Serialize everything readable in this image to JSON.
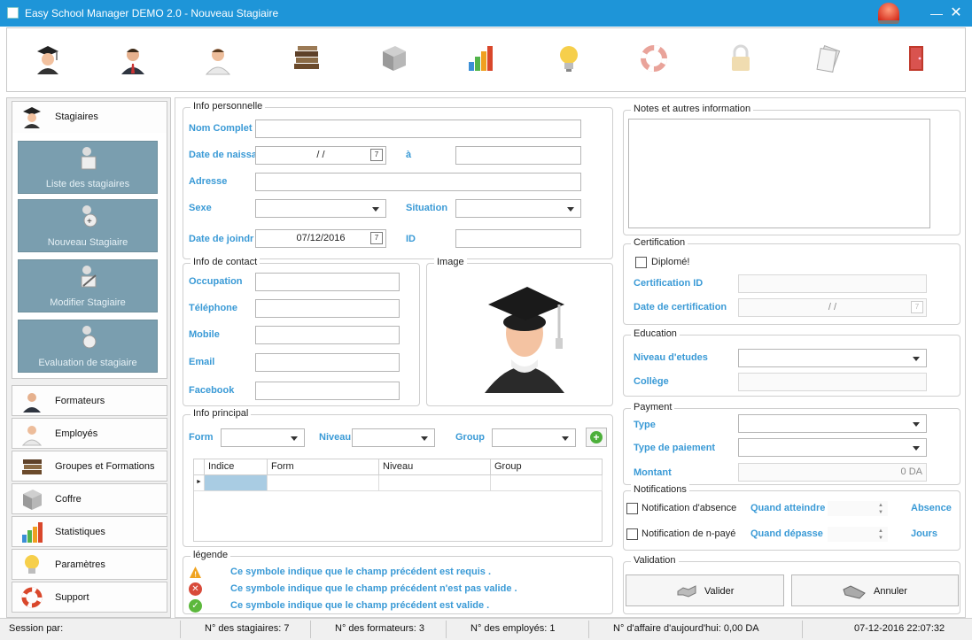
{
  "window": {
    "title": "Easy School Manager DEMO 2.0 - Nouveau Stagiaire"
  },
  "toolbar": {
    "icons": [
      "graduate-icon",
      "teacher-icon",
      "employee-icon",
      "books-icon",
      "safe-icon",
      "chart-icon",
      "bulb-icon",
      "lifebuoy-icon",
      "lock-icon",
      "documents-icon",
      "exit-door-icon"
    ]
  },
  "sidebar": {
    "stagiaires": "Stagiaires",
    "subs": [
      "Liste des stagiaires",
      "Nouveau Stagiaire",
      "Modifier Stagiaire",
      "Evaluation de stagiaire"
    ],
    "items": [
      "Formateurs",
      "Employés",
      "Groupes et Formations",
      "Coffre",
      "Statistiques",
      "Paramètres",
      "Support"
    ]
  },
  "personal": {
    "title": "Info personnelle",
    "nom_label": "Nom Complet",
    "nom_value": "",
    "dob_label": "Date de naissa",
    "dob_value": "/ /",
    "a_label": "à",
    "a_value": "",
    "adresse_label": "Adresse",
    "adresse_value": "",
    "sexe_label": "Sexe",
    "sexe_value": "",
    "situation_label": "Situation",
    "situation_value": "",
    "join_label": "Date de joindr",
    "join_value": "07/12/2016",
    "id_label": "ID",
    "id_value": ""
  },
  "contact": {
    "title": "Info de contact",
    "fields": [
      {
        "label": "Occupation",
        "value": ""
      },
      {
        "label": "Téléphone",
        "value": ""
      },
      {
        "label": "Mobile",
        "value": ""
      },
      {
        "label": "Email",
        "value": ""
      },
      {
        "label": "Facebook",
        "value": ""
      }
    ]
  },
  "image": {
    "title": "Image"
  },
  "principal": {
    "title": "Info principal",
    "form_label": "Form",
    "form_value": "",
    "niveau_label": "Niveau",
    "niveau_value": "",
    "group_label": "Group",
    "group_value": "",
    "columns": [
      "Indice",
      "Form",
      "Niveau",
      "Group"
    ]
  },
  "legend": {
    "title": "légende",
    "rows": [
      {
        "icon": "warning-icon",
        "text": "Ce symbole indique que le champ précédent est requis ."
      },
      {
        "icon": "invalid-icon",
        "text": "Ce symbole indique que le champ précédent n'est pas valide ."
      },
      {
        "icon": "valid-icon",
        "text": "Ce symbole indique que le champ précédent est valide ."
      }
    ]
  },
  "notes": {
    "title": "Notes et autres information",
    "value": ""
  },
  "certification": {
    "title": "Certification",
    "diplome": "Diplomé!",
    "id_label": "Certification ID",
    "id_value": "",
    "date_label": "Date de certification",
    "date_value": "/ /"
  },
  "education": {
    "title": "Education",
    "niveau_label": "Niveau d'etudes",
    "niveau_value": "",
    "college_label": "Collège",
    "college_value": ""
  },
  "payment": {
    "title": "Payment",
    "type_label": "Type",
    "type_value": "",
    "paiement_label": "Type de paiement",
    "paiement_value": "",
    "montant_label": "Montant",
    "montant_value": "0 DA"
  },
  "notifications": {
    "title": "Notifications",
    "absence_label": "Notification d'absence",
    "absence_cond": "Quand atteindre",
    "absence_unit": "Absence",
    "npaye_label": "Notification de n-payé",
    "npaye_cond": "Quand dépasse",
    "npaye_unit": "Jours"
  },
  "validation": {
    "title": "Validation",
    "valider": "Valider",
    "annuler": "Annuler"
  },
  "status": {
    "session": "Session par:",
    "stagiaires": "N° des stagiaires: 7",
    "formateurs": "N° des formateurs: 3",
    "employes": "N° des employés: 1",
    "affaire": "N° d'affaire d'aujourd'hui: 0,00 DA",
    "datetime": "07-12-2016 22:07:32"
  },
  "colors": {
    "titlebar": "#1e95d8",
    "label": "#3a9ad6",
    "sub_button": "#7a9eaf"
  }
}
